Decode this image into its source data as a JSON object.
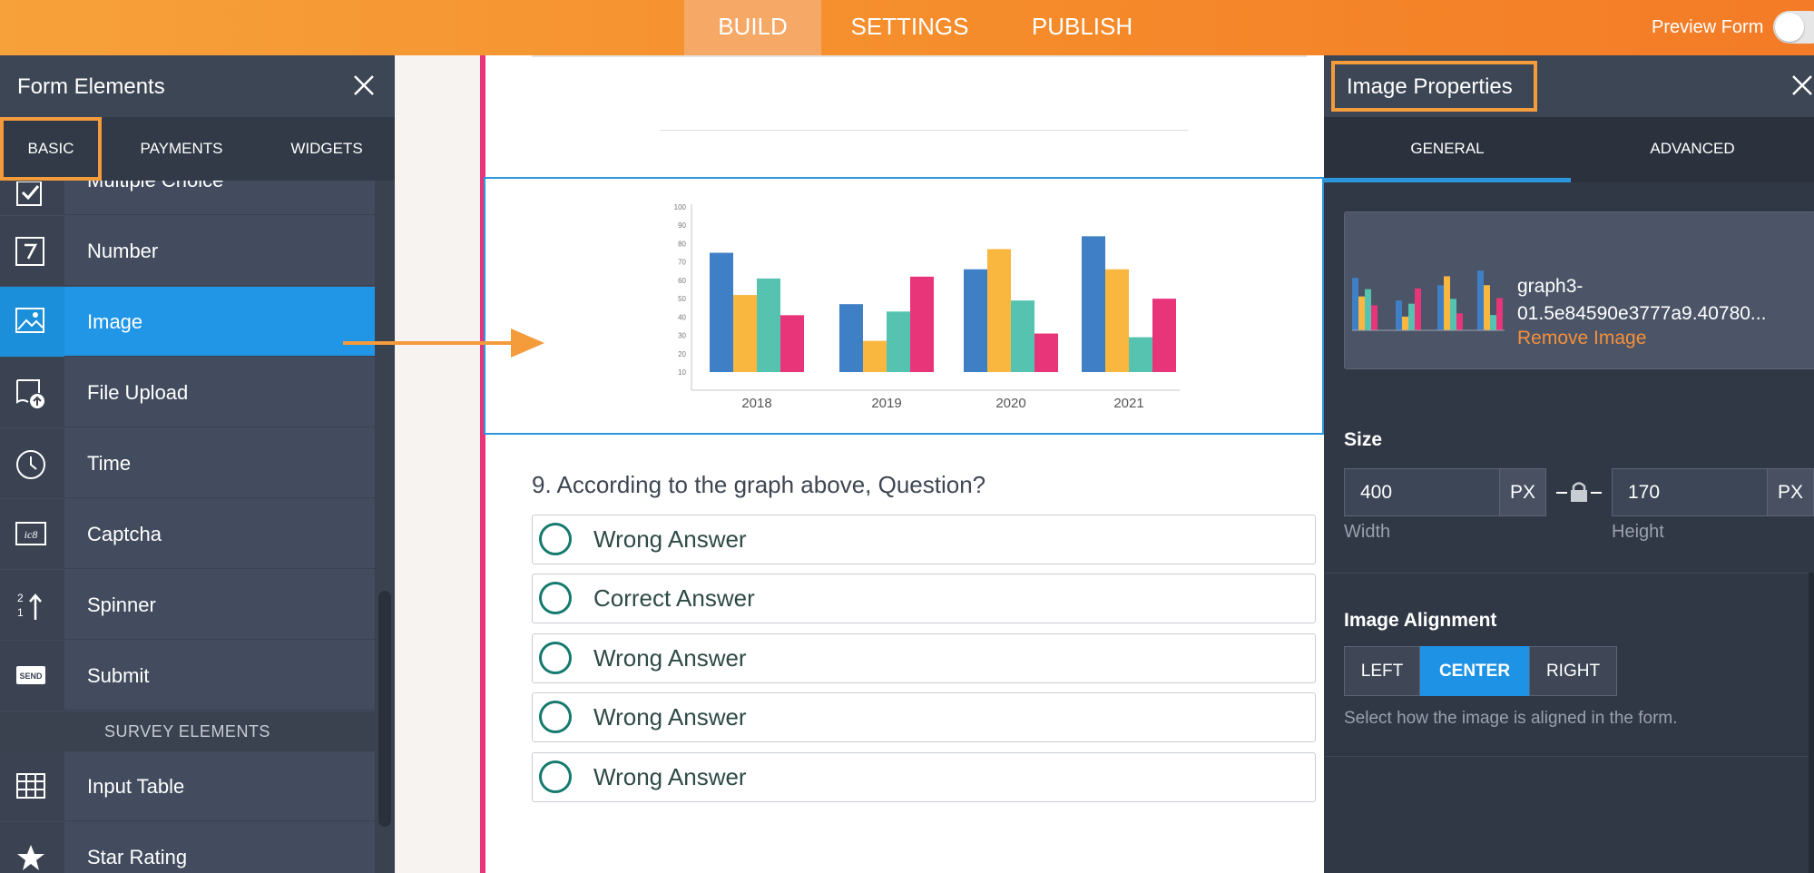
{
  "topbar": {
    "tabs": [
      "BUILD",
      "SETTINGS",
      "PUBLISH"
    ],
    "preview_label": "Preview Form",
    "preview_enabled": false
  },
  "left_panel": {
    "title": "Form Elements",
    "tabs": [
      "BASIC",
      "PAYMENTS",
      "WIDGETS"
    ],
    "active_tab": "BASIC",
    "elements": [
      {
        "label": "Multiple Choice",
        "icon": "checkbox-icon"
      },
      {
        "label": "Number",
        "icon": "number-icon"
      },
      {
        "label": "Image",
        "icon": "image-icon"
      },
      {
        "label": "File Upload",
        "icon": "file-upload-icon"
      },
      {
        "label": "Time",
        "icon": "clock-icon"
      },
      {
        "label": "Captcha",
        "icon": "captcha-icon"
      },
      {
        "label": "Spinner",
        "icon": "spinner-icon"
      },
      {
        "label": "Submit",
        "icon": "send-icon"
      }
    ],
    "active_element": "Image",
    "captcha_icon_text": "ic8",
    "send_icon_text": "SEND",
    "spinner_icon_text": "2\n1",
    "survey_header": "SURVEY ELEMENTS",
    "survey_elements": [
      {
        "label": "Input Table",
        "icon": "table-icon"
      },
      {
        "label": "Star Rating",
        "icon": "star-icon"
      }
    ]
  },
  "form": {
    "question": "9. According to the graph above, Question?",
    "options": [
      "Wrong Answer",
      "Correct Answer",
      "Wrong Answer",
      "Wrong Answer",
      "Wrong Answer"
    ]
  },
  "chart_data": {
    "type": "bar",
    "categories": [
      "2018",
      "2019",
      "2020",
      "2021"
    ],
    "series": [
      {
        "color": "#3f7fc5",
        "values": [
          75,
          47,
          66,
          84
        ]
      },
      {
        "color": "#f9b740",
        "values": [
          52,
          27,
          77,
          66
        ]
      },
      {
        "color": "#56c3b0",
        "values": [
          61,
          43,
          49,
          29
        ]
      },
      {
        "color": "#e8357a",
        "values": [
          41,
          62,
          31,
          50
        ]
      }
    ],
    "yticks": [
      10,
      20,
      30,
      40,
      50,
      60,
      70,
      80,
      90,
      100
    ],
    "ylim": [
      10,
      100
    ],
    "grid": false
  },
  "right_panel": {
    "title": "Image Properties",
    "tabs": [
      "GENERAL",
      "ADVANCED"
    ],
    "active_tab": "GENERAL",
    "image_name": "graph3-01.5e84590e3777a9.40780...",
    "remove_label": "Remove Image",
    "size_label": "Size",
    "width_value": "400",
    "height_value": "170",
    "unit": "PX",
    "width_label": "Width",
    "height_label": "Height",
    "alignment_label": "Image Alignment",
    "alignment_options": [
      "LEFT",
      "CENTER",
      "RIGHT"
    ],
    "alignment_selected": "CENTER",
    "alignment_help": "Select how the image is aligned in the form."
  },
  "colors": {
    "brand_orange": "#f58a2a",
    "accent_blue": "#2196e6",
    "form_border_pink": "#e8357a",
    "highlight_orange": "#f49b3c"
  }
}
